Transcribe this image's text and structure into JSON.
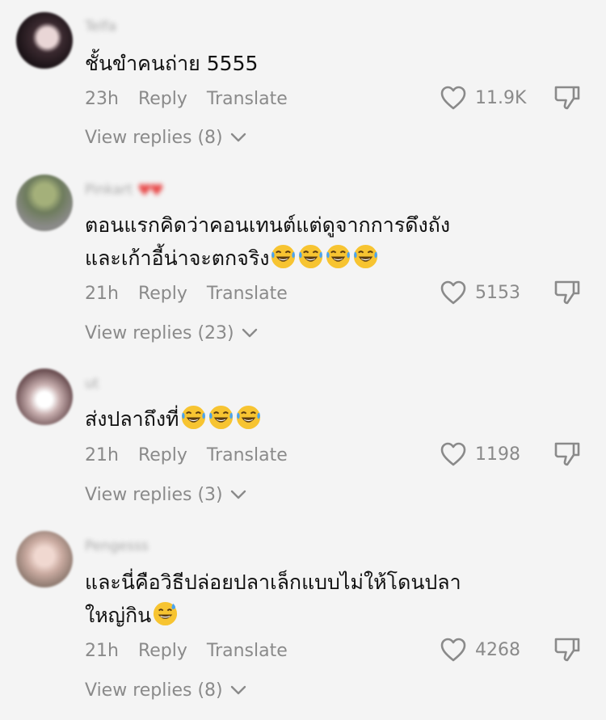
{
  "comments": [
    {
      "username": "Telfa",
      "username_hearts": "",
      "text_lines": [
        "ชั้นขำคนถ่าย 5555"
      ],
      "emojis": [],
      "time": "23h",
      "reply_label": "Reply",
      "translate_label": "Translate",
      "likes": "11.9K",
      "view_replies": "View replies (8)"
    },
    {
      "username": "Pinkart",
      "username_hearts": "♥♥",
      "text_lines": [
        "ตอนแรกคิดว่าคอนเทนต์แต่ดูจากการดึงถัง",
        "และเก้าอี้น่าจะตกจริง"
      ],
      "emojis": [
        "joy-emoji",
        "joy-emoji",
        "joy-emoji",
        "joy-emoji"
      ],
      "time": "21h",
      "reply_label": "Reply",
      "translate_label": "Translate",
      "likes": "5153",
      "view_replies": "View replies (23)"
    },
    {
      "username": "ut",
      "username_hearts": "",
      "text_lines": [
        "ส่งปลาถึงที่"
      ],
      "emojis": [
        "joy-emoji",
        "joy-emoji",
        "joy-emoji"
      ],
      "time": "21h",
      "reply_label": "Reply",
      "translate_label": "Translate",
      "likes": "1198",
      "view_replies": "View replies (3)"
    },
    {
      "username": "Pengesss",
      "username_hearts": "",
      "text_lines": [
        "และนี่คือวิธีปล่อยปลาเล็กแบบไม่ให้โดนปลา",
        "ใหญ่กิน"
      ],
      "emojis": [
        "sweat-smile-emoji"
      ],
      "time": "21h",
      "reply_label": "Reply",
      "translate_label": "Translate",
      "likes": "4268",
      "view_replies": "View replies (8)"
    }
  ],
  "colors": {
    "background": "#f4f4f4",
    "text": "#111111",
    "muted": "#8a8a8a",
    "emoji_face": "#f7c431"
  },
  "icons": [
    "heart-outline-icon",
    "dislike-icon",
    "chevron-down-icon"
  ]
}
